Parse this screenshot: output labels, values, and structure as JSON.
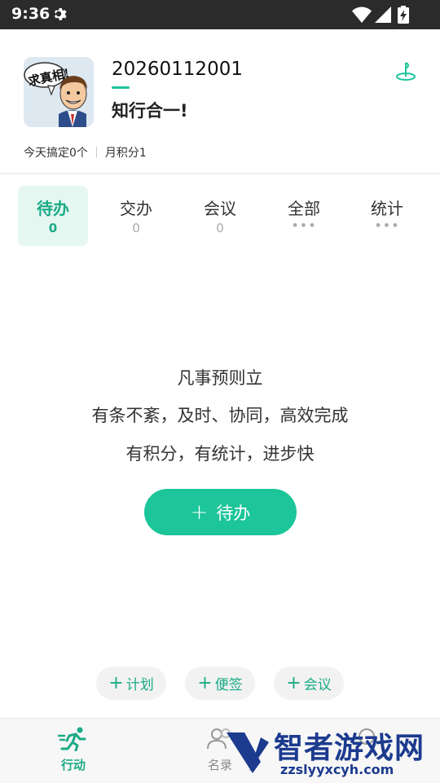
{
  "status_bar": {
    "time": "9:36"
  },
  "profile": {
    "avatar_caption": "求真相!",
    "user_id": "20260112001",
    "motto": "知行合一!",
    "stats": [
      "今天搞定0个",
      "月积分1"
    ]
  },
  "tabs": [
    {
      "label": "待办",
      "count": "0",
      "active": true
    },
    {
      "label": "交办",
      "count": "0",
      "active": false
    },
    {
      "label": "会议",
      "count": "0",
      "active": false
    },
    {
      "label": "全部",
      "count": "•••",
      "active": false
    },
    {
      "label": "统计",
      "count": "•••",
      "active": false
    }
  ],
  "empty_state": {
    "line1": "凡事预则立",
    "line2": "有条不紊，及时、协同，高效完成",
    "line3": "有积分，有统计，进步快"
  },
  "primary_action": {
    "plus": "+",
    "label": "待办"
  },
  "quick_actions": [
    {
      "plus": "+",
      "label": "计划"
    },
    {
      "plus": "+",
      "label": "便签"
    },
    {
      "plus": "+",
      "label": "会议"
    }
  ],
  "bottom_nav": [
    {
      "label": "行动",
      "active": true
    },
    {
      "label": "名录",
      "active": false
    },
    {
      "label": "",
      "active": false
    }
  ],
  "watermark": {
    "text": "智者游戏网",
    "url": "zzslyyxcyh.com"
  },
  "colors": {
    "accent": "#1cc59a",
    "accent_dark": "#1bab86",
    "status_bar": "#2b2b2b"
  }
}
